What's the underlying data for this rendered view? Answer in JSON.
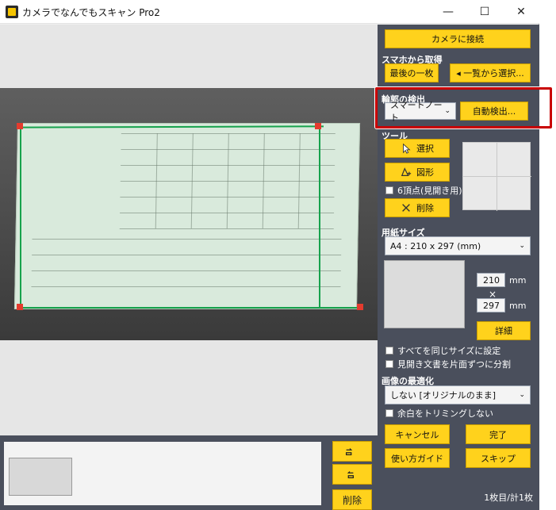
{
  "window": {
    "title": "カメラでなんでもスキャン Pro2",
    "min": "—",
    "max": "☐",
    "close": "✕"
  },
  "panel": {
    "connect_camera": "カメラに接続",
    "smartphone_heading": "スマホから取得",
    "last_one": "最後の一枚",
    "pick_from_list": "◂ 一覧から選択...",
    "edge_heading": "輪郭の検出",
    "edge_mode": "スマートノート",
    "auto_detect": "自動検出...",
    "tools_heading": "ツール",
    "select": "選択",
    "shape": "図形",
    "six_points": "6頂点(見開き用)",
    "delete": "削除",
    "paper_heading": "用紙サイズ",
    "paper_size": "A4 : 210 x 297 (mm)",
    "width": "210",
    "height": "297",
    "mm1": "mm",
    "mm2": "mm",
    "times": "×",
    "details": "詳細",
    "same_size": "すべてを同じサイズに設定",
    "split_pages": "見開き文書を片面ずつに分割",
    "optimize_heading": "画像の最適化",
    "optimize_mode": "しない [オリジナルのまま]",
    "trim_margin": "余白をトリミングしない",
    "cancel": "キャンセル",
    "finish": "完了",
    "guide": "使い方ガイド",
    "skip": "スキップ",
    "status": "1枚目/計1枚"
  },
  "strip": {
    "delete": "削除"
  },
  "colors": {
    "accent": "#ffd21c",
    "panel": "#4a4f5c",
    "highlight": "#c90000",
    "corner": "#e43b2e",
    "border": "#17a24d"
  }
}
